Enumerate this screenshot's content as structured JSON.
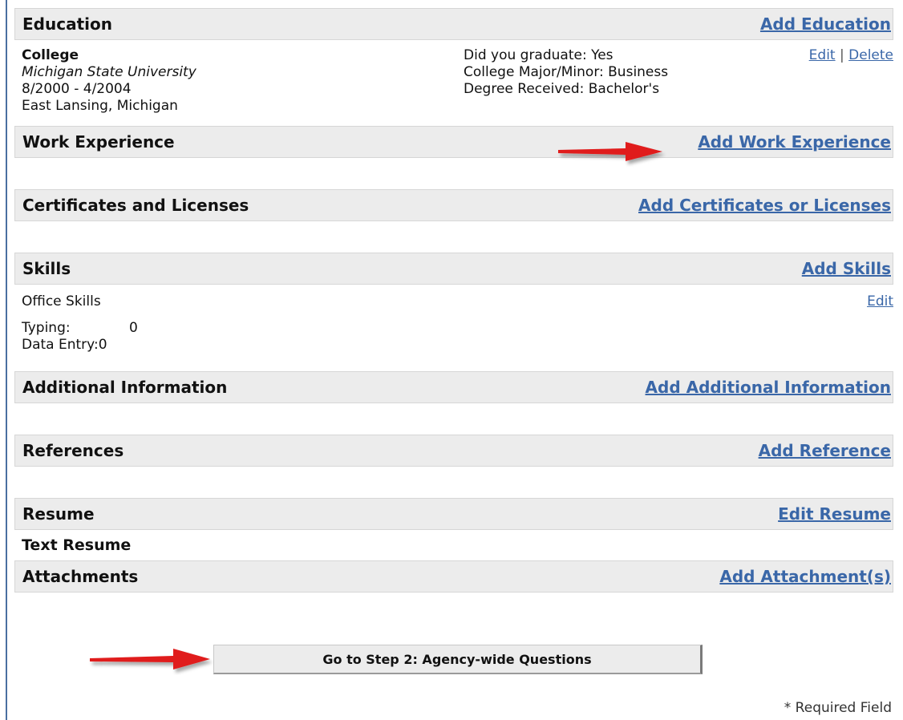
{
  "sections": {
    "education": {
      "title": "Education",
      "action": "Add Education"
    },
    "work": {
      "title": "Work Experience",
      "action": "Add Work Experience"
    },
    "certs": {
      "title": "Certificates and Licenses",
      "action": "Add Certificates or Licenses"
    },
    "skills": {
      "title": "Skills",
      "action": "Add Skills"
    },
    "additional": {
      "title": "Additional Information",
      "action": "Add Additional Information"
    },
    "references": {
      "title": "References",
      "action": "Add Reference"
    },
    "resume": {
      "title": "Resume",
      "action": "Edit Resume"
    },
    "attachments": {
      "title": "Attachments",
      "action": "Add Attachment(s)"
    }
  },
  "education_entry": {
    "level": "College",
    "school": "Michigan State University",
    "dates": "8/2000 - 4/2004",
    "location": "East Lansing, Michigan",
    "graduated": "Did you graduate: Yes",
    "major": "College Major/Minor: Business",
    "degree": "Degree Received: Bachelor's",
    "edit": "Edit",
    "separator": "|",
    "delete": "Delete"
  },
  "skills_entry": {
    "category": "Office Skills",
    "edit": "Edit",
    "items": [
      {
        "label": "Typing:",
        "value": "0"
      },
      {
        "label": "Data Entry:",
        "value": "0"
      }
    ]
  },
  "resume_entry": {
    "text": "Text Resume"
  },
  "step_button": "Go to Step 2: Agency-wide Questions",
  "required_note": "* Required Field",
  "colors": {
    "link": "#3a67a8",
    "header_bg": "#ececec",
    "arrow": "#e01a1a"
  }
}
